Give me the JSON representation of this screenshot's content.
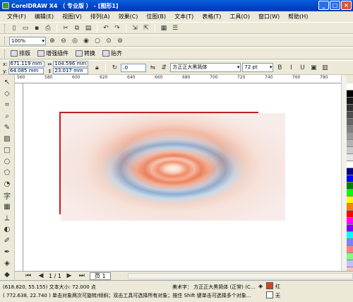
{
  "window": {
    "title": "CorelDRAW X4 （ 专业版 ） - [图形1]"
  },
  "menu": [
    "文件(F)",
    "编辑(E)",
    "视图(V)",
    "排列(A)",
    "效果(C)",
    "位图(B)",
    "文本(T)",
    "表格(T)",
    "工具(O)",
    "窗口(W)",
    "帮助(H)"
  ],
  "zoom": "100%",
  "dockers": [
    "排版",
    "增强插件",
    "转换",
    "贴齐"
  ],
  "properties": {
    "x": "671.119 mm",
    "y": "64.085 mm",
    "width": "104.596 mm",
    "height": "23.017 mm",
    "rotation": ".0",
    "font": "方正正大黑简体",
    "font_size": "72 pt"
  },
  "ruler_labels": [
    "560",
    "580",
    "600",
    "620",
    "640",
    "660",
    "680",
    "700",
    "720",
    "740",
    "760",
    "780"
  ],
  "page_nav": {
    "counter": "1 / 1",
    "tab": "页 1"
  },
  "status": {
    "line1": "(618.820, 55.155)  文本大小: 72.000 点",
    "line2": "( 772.638, 22.740 )  单击对象两次可旋转/倾斜；双击工具可选择所有对象；按住 Shift 键单击可选择多个对象...",
    "object": "美术字： 方正正大黑简体 (正常) (C...",
    "fill_label": "红",
    "outline_label": "无"
  },
  "colors": {
    "accent": "#0a5fd8",
    "page_border": "#c02020",
    "palette": [
      "#ffffff",
      "#000000",
      "#1a1a1a",
      "#333333",
      "#4d4d4d",
      "#666666",
      "#808080",
      "#999999",
      "#b3b3b3",
      "#cccccc",
      "#e6e6e6",
      "#ffffff",
      "#000080",
      "#0000ff",
      "#008000",
      "#00ff00",
      "#ffff00",
      "#ff8000",
      "#ff0000",
      "#ff00ff",
      "#8000ff",
      "#00ffff",
      "#8080ff",
      "#ff8080",
      "#80ff80",
      "#c0c0ff",
      "#ffc0c0"
    ]
  }
}
